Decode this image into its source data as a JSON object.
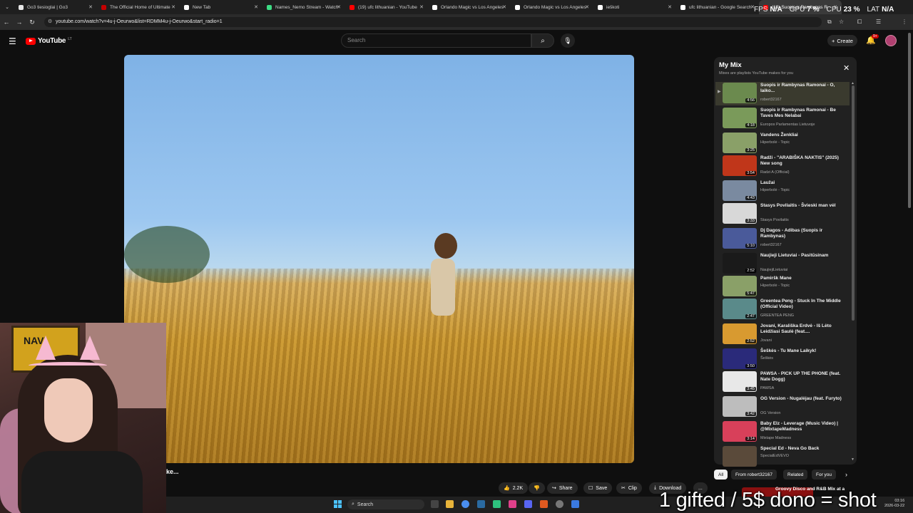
{
  "browser": {
    "tabs": [
      {
        "title": "Go3 tiesioglai | Go3",
        "color": "#e6e6e6"
      },
      {
        "title": "The Official Home of Ultimate",
        "color": "#c40000"
      },
      {
        "title": "New Tab",
        "color": "#ffffff"
      },
      {
        "title": "Names_Nemo Stream - Watch",
        "color": "#3ddc84"
      },
      {
        "title": "(19) ufc lithuanian - YouTube",
        "color": "#ff0000"
      },
      {
        "title": "Orlando Magic vs Los Angeles",
        "color": "#ffffff"
      },
      {
        "title": "Orlando Magic vs Los Angeles",
        "color": "#ffffff"
      },
      {
        "title": "ieškoti",
        "color": "#ffffff"
      },
      {
        "title": "ufc lithuanian - Google Search",
        "color": "#ffffff"
      },
      {
        "title": "(19) Suopis ir Rambynas R",
        "color": "#ff0000"
      }
    ],
    "url": "youtube.com/watch?v=4u-j-Oeurwo&list=RDMM4u-j-Oeurwo&start_radio=1"
  },
  "perf": {
    "fps_label": "FPS",
    "fps_value": "N/A",
    "gpu_label": "GPU",
    "gpu_value": "7 %",
    "cpu_label": "CPU",
    "cpu_value": "23 %",
    "lat_label": "LAT",
    "lat_value": "N/A"
  },
  "youtube": {
    "logo_text": "YouTube",
    "logo_country": "LT",
    "search_placeholder": "Search",
    "create_label": "Create",
    "notifications_badge": "9+",
    "video_caption": "ke...",
    "actions": {
      "like_count": "2.2K",
      "share": "Share",
      "save": "Save",
      "clip": "Clip",
      "download": "Download",
      "more": "..."
    }
  },
  "playlist": {
    "title": "My Mix",
    "subtitle": "Mixes are playlists YouTube makes for you",
    "items": [
      {
        "title": "Suopis ir Rambynas Ramonai - O, laiko...",
        "channel": "robert32167",
        "duration": "4:56",
        "thumb": "#6b8a4e"
      },
      {
        "title": "Suopis ir Rambynas Ramonai - Be Taves Mes Nelabai",
        "channel": "Europos Parlamentas Lietuvoje",
        "duration": "4:18",
        "thumb": "#7a9a5a"
      },
      {
        "title": "Vandens Ženkliai",
        "channel": "Hiperbolė - Topic",
        "duration": "3:25",
        "thumb": "#8aa068"
      },
      {
        "title": "Radži - \"ARABIŠKA NAKTIS\" (2025) New song",
        "channel": "Radzi A (Official)",
        "duration": "3:54",
        "thumb": "#c0361a"
      },
      {
        "title": "Laužai",
        "channel": "Hiperbolė - Topic",
        "duration": "4:43",
        "thumb": "#7a8aa0"
      },
      {
        "title": "Stasys Povilaitis - Švieski man vėl",
        "channel": "Stasys Povilaitis",
        "duration": "3:33",
        "thumb": "#d8d8d8"
      },
      {
        "title": "Dj Dagos - Adibas (Suopis ir Rambynas)",
        "channel": "robert32167",
        "duration": "5:10",
        "thumb": "#4a5a9a"
      },
      {
        "title": "Naujieji Lietuviai - Pasitūsinam",
        "channel": "NaujiejiLietuviai",
        "duration": "2:52",
        "thumb": "#1a1a1a"
      },
      {
        "title": "Pamiršk Mane",
        "channel": "Hiperbolė - Topic",
        "duration": "5:47",
        "thumb": "#8aa068"
      },
      {
        "title": "Greentea Peng - Stuck In The Middle (Official Video)",
        "channel": "GREENTEA PENG",
        "duration": "2:47",
        "thumb": "#5a8a8a"
      },
      {
        "title": "Jovani, Karališka Erdvė - Iš Lėto Leidžiasi Saulė (feat....",
        "channel": "Jovani",
        "duration": "2:52",
        "thumb": "#d89a30"
      },
      {
        "title": "Šeškės - Tu Mane Laikyk!",
        "channel": "Šeškės",
        "duration": "3:50",
        "thumb": "#2a2a7a"
      },
      {
        "title": "PAWSA - PICK UP THE PHONE (feat. Nate Dogg)",
        "channel": "PAWSA",
        "duration": "3:45",
        "thumb": "#e8e8e8"
      },
      {
        "title": "OG Version - Nugalėjau (feat. Furyto)",
        "channel": "OG Version",
        "duration": "3:42",
        "thumb": "#bdbdbd"
      },
      {
        "title": "Baby Elz - Leverage (Music Video) | @MixtapeMadness",
        "channel": "Mixtape Madness",
        "duration": "3:14",
        "thumb": "#d8405a"
      },
      {
        "title": "Special Ed - Neva Go Back",
        "channel": "SpecialEdVEVO",
        "duration": "",
        "thumb": "#5a4a3a"
      }
    ]
  },
  "chips": [
    "All",
    "From robert32167",
    "Related",
    "For you"
  ],
  "next_up": {
    "title": "Groovy Disco and R&B Mix at a"
  },
  "taskbar": {
    "search": "Search",
    "time": "03:16",
    "date": "2026-03-22"
  },
  "overlay_text": "1 gifted / 5$ dono = shot"
}
